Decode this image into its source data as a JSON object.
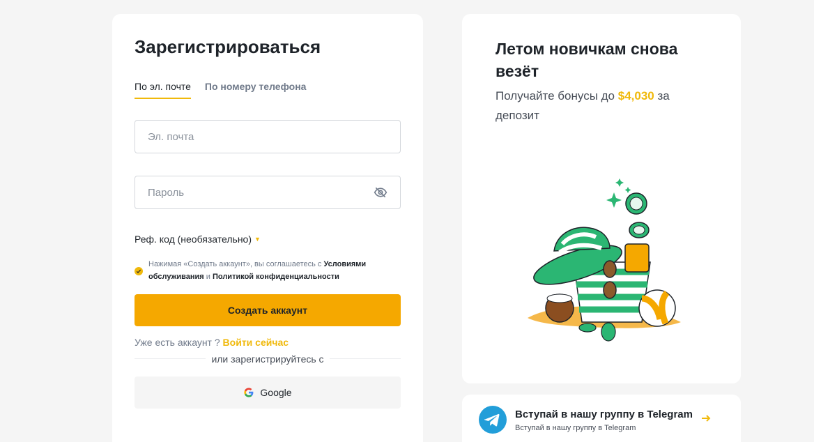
{
  "form": {
    "title": "Зарегистрироваться",
    "tabs": [
      {
        "label": "По эл. почте",
        "active": true
      },
      {
        "label": "По номеру телефона",
        "active": false
      }
    ],
    "email_placeholder": "Эл. почта",
    "password_placeholder": "Пароль",
    "ref_label": "Реф. код (необязательно)",
    "agreement": {
      "prefix": "Нажимая «Создать аккаунт», вы соглашаетесь с ",
      "terms": "Условиями обслуживания",
      "and": " и ",
      "privacy": "Политикой конфиденциальности"
    },
    "submit_label": "Создать аккаунт",
    "have_account": "Уже есть аккаунт ? ",
    "login_link": "Войти сейчас",
    "or_register_with": "или зарегистрируйтесь с",
    "google_label": "Google"
  },
  "promo": {
    "title": "Летом новичкам снова везёт",
    "sub_prefix": "Получайте бонусы до ",
    "amount": "$4,030",
    "sub_suffix": " за депозит"
  },
  "telegram": {
    "title": "Вступай в нашу группу в Telegram",
    "subtitle": "Вступай в нашу группу в Telegram"
  },
  "colors": {
    "accent": "#f0b90b",
    "button": "#f5a800",
    "telegram": "#229ed9",
    "stripe_green": "#2bb673"
  },
  "icons": [
    "eye-off-icon",
    "check-icon",
    "caret-down-icon",
    "google-icon",
    "telegram-icon",
    "arrow-right-icon"
  ]
}
